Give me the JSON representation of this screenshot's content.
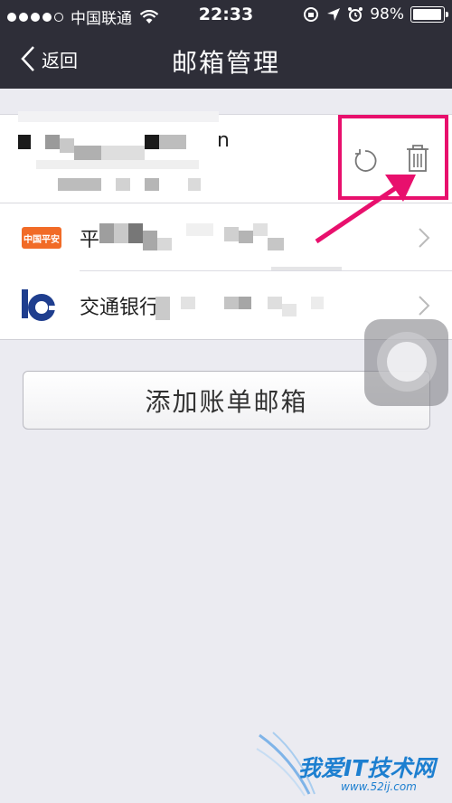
{
  "status_bar": {
    "carrier": "中国联通",
    "time": "22:33",
    "battery": "98%",
    "battery_level": 0.98
  },
  "nav": {
    "back_label": "返回",
    "title": "邮箱管理"
  },
  "email_account": {
    "visible_char": "n"
  },
  "banks": [
    {
      "label": "平",
      "logo_text": "中国平安"
    },
    {
      "label": "交通银行"
    }
  ],
  "add_button": {
    "label": "添加账单邮箱"
  },
  "watermark": {
    "text": "我爱IT技术网",
    "url": "www.52ij.com"
  },
  "colors": {
    "nav_bg": "#2e2e38",
    "highlight": "#e8106d",
    "pingan_orange": "#f16b27",
    "bocom_blue": "#1f3e8e"
  },
  "icons": [
    "wifi-icon",
    "lock-rotation-icon",
    "location-arrow-icon",
    "alarm-icon",
    "back-chevron-icon",
    "refresh-icon",
    "trash-icon",
    "chevron-right-icon"
  ]
}
